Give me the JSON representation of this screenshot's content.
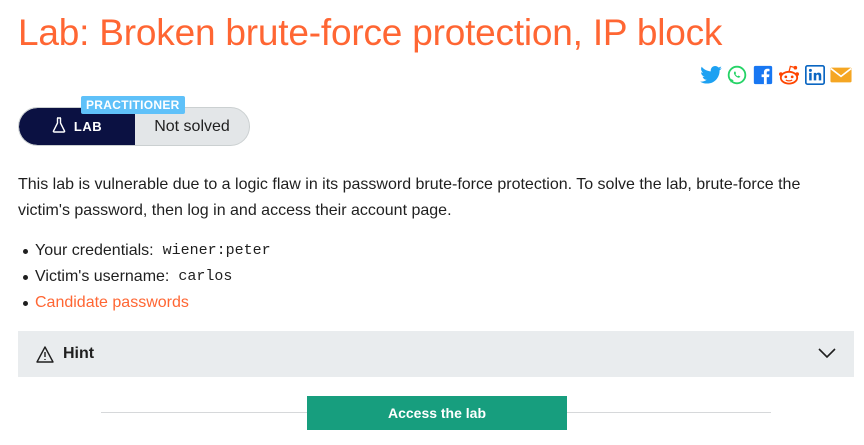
{
  "page_title": "Lab: Broken brute-force protection, IP block",
  "share_icons": [
    {
      "name": "twitter",
      "color": "#1da1f2"
    },
    {
      "name": "whatsapp",
      "color": "#25d366"
    },
    {
      "name": "facebook",
      "color": "#1877f2"
    },
    {
      "name": "reddit",
      "color": "#ff4500"
    },
    {
      "name": "linkedin",
      "color": "#0a66c2"
    },
    {
      "name": "email",
      "color": "#f5a623"
    }
  ],
  "level": {
    "tag": "PRACTITIONER",
    "lab_label": "LAB",
    "status": "Not solved"
  },
  "description": "This lab is vulnerable due to a logic flaw in its password brute-force protection. To solve the lab, brute-force the victim's password, then log in and access their account page.",
  "credentials": {
    "yours_label": "Your credentials:",
    "yours_value": "wiener:peter",
    "victim_label": "Victim's username:",
    "victim_value": "carlos",
    "candidate_link": "Candidate passwords"
  },
  "hint": {
    "label": "Hint"
  },
  "access_button": "Access the lab",
  "colors": {
    "title": "#ff6633",
    "lab_pill": "#0b1142",
    "level_tag": "#5fc1f9",
    "access_button": "#179e7e"
  }
}
